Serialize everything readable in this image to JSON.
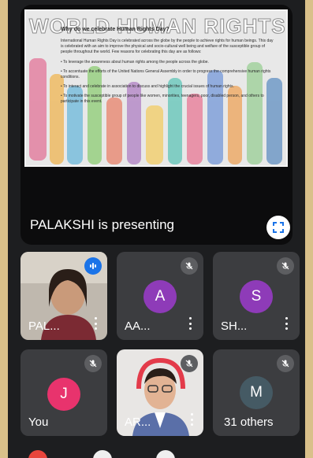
{
  "presentation": {
    "presenter_label": "PALAKSHI is presenting",
    "slide": {
      "bg_title": "WORLD HUMAN RIGHTS DAY",
      "heading": "Why do we celebrate Human Rights Day?",
      "paragraph": "International Human Rights Day is celebrated across the globe by the people to achieve rights for human beings. This day is celebrated with an aim to improve the physical and socio-cultural well being and welfare of the susceptible group of people throughout the world. Few reasons for celebrating this day are as follows:",
      "bullets": [
        "• To leverage the awareness about human rights among the people across the globe.",
        "• To accentuate the efforts of the United Nations General Assembly in order to progress the comprehensive human rights conditions.",
        "• To interact and celebrate in association to discuss and highlight the crucial issues of human rights.",
        "• To motivate the susceptible group of people like women, minorities, teenagers, poor, disabled person, and others to participate in this event."
      ]
    }
  },
  "participants": [
    {
      "name": "PAL...",
      "type": "video"
    },
    {
      "name": "AA...",
      "initial": "A",
      "color": "#8e3bb8"
    },
    {
      "name": "SH...",
      "initial": "S",
      "color": "#8e3bb8"
    },
    {
      "name": "You",
      "initial": "J",
      "color": "#e8336d"
    },
    {
      "name": "AR...",
      "type": "video"
    },
    {
      "name": "31 others",
      "initial": "M",
      "color": "#455a64"
    }
  ],
  "colors": {
    "accent_blue": "#1a73e8",
    "tile_bg": "#3c3d40",
    "screen_bg": "#1d1e20"
  },
  "icons": {
    "fullscreen": "fullscreen-icon",
    "mic_off": "mic-off-icon",
    "more": "more-vert-icon",
    "speaking": "audio-level-icon"
  }
}
